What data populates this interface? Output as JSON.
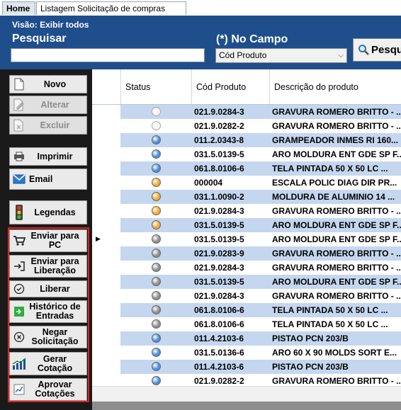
{
  "tabs": {
    "home": "Home",
    "listing": "Listagem Solicitação de compras"
  },
  "header": {
    "visao": "Visão:  Exibir todos",
    "search_label": "Pesquisar",
    "search_value": "",
    "field_label": "(*) No Campo",
    "field_selected": "Cód Produto",
    "search_button": "Pesquisar"
  },
  "sidebar": {
    "novo": "Novo",
    "alterar": "Alterar",
    "excluir": "Excluir",
    "imprimir": "Imprimir",
    "email": "Email",
    "legendas": "Legendas",
    "enviar_pc": "Enviar para PC",
    "enviar_lib": "Enviar para Liberação",
    "liberar": "Liberar",
    "historico": "Histórico de Entradas",
    "negar": "Negar Solicitação",
    "gerar": "Gerar Cotação",
    "aprovar": "Aprovar Cotações"
  },
  "grid": {
    "columns": [
      "Status",
      "Cód Produto",
      "Descrição do produto"
    ],
    "status_colors": {
      "white": "#f4f4f4",
      "blue": "#4a8fd8",
      "orange": "#f0a830",
      "gray": "#8f8f8f"
    },
    "rows": [
      {
        "status": "white",
        "cod": "021.9.0284-3",
        "desc": "GRAVURA ROMERO BRITTO - ..."
      },
      {
        "status": "white",
        "cod": "021.9.0282-2",
        "desc": "GRAVURA ROMERO BRITTO - ..."
      },
      {
        "status": "blue",
        "cod": "011.2.0343-8",
        "desc": "GRAMPEADOR INMES RI 160..."
      },
      {
        "status": "blue",
        "cod": "031.5.0139-5",
        "desc": "ARO MOLDURA ENT GDE SP F..."
      },
      {
        "status": "blue",
        "cod": "061.8.0106-6",
        "desc": "TELA PINTADA 50 X 50  LC  ..."
      },
      {
        "status": "orange",
        "cod": "000004",
        "desc": "ESCALA POLIC DIAG DIR PR..."
      },
      {
        "status": "orange",
        "cod": "031.1.0090-2",
        "desc": "MOLDURA DE ALUMINIO 14 ..."
      },
      {
        "status": "orange",
        "cod": "021.9.0284-3",
        "desc": "GRAVURA ROMERO BRITTO - ..."
      },
      {
        "status": "orange",
        "cod": "031.5.0139-5",
        "desc": "ARO MOLDURA ENT GDE SP F..."
      },
      {
        "status": "gray",
        "cod": "031.5.0139-5",
        "desc": "ARO MOLDURA ENT GDE SP F...",
        "current": true
      },
      {
        "status": "gray",
        "cod": "021.9.0283-9",
        "desc": "GRAVURA ROMERO BRITTO - ..."
      },
      {
        "status": "gray",
        "cod": "021.9.0284-3",
        "desc": "GRAVURA ROMERO BRITTO - ..."
      },
      {
        "status": "gray",
        "cod": "031.5.0139-5",
        "desc": "ARO MOLDURA ENT GDE SP F..."
      },
      {
        "status": "gray",
        "cod": "021.9.0284-3",
        "desc": "GRAVURA ROMERO BRITTO - ..."
      },
      {
        "status": "gray",
        "cod": "061.8.0106-6",
        "desc": "TELA PINTADA 50 X 50  LC  ..."
      },
      {
        "status": "gray",
        "cod": "061.8.0106-6",
        "desc": "TELA PINTADA 50 X 50  LC  ..."
      },
      {
        "status": "blue",
        "cod": "011.4.2103-6",
        "desc": "PISTAO PCN 203/B"
      },
      {
        "status": "blue",
        "cod": "031.5.0136-6",
        "desc": "ARO 60 X 90 MOLDS SORT E..."
      },
      {
        "status": "blue",
        "cod": "011.4.2103-6",
        "desc": "PISTAO PCN 203/B"
      },
      {
        "status": "blue",
        "cod": "021.9.0282-2",
        "desc": "GRAVURA ROMERO BRITTO - ..."
      }
    ]
  }
}
